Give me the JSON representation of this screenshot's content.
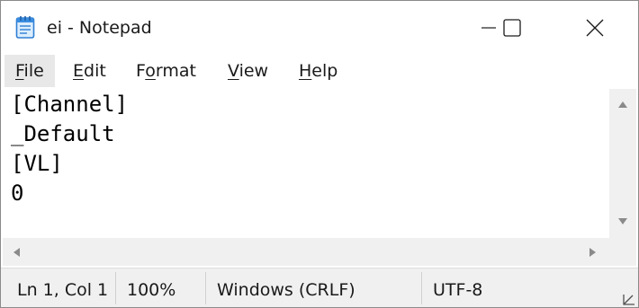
{
  "window": {
    "title": "ei - Notepad",
    "app_icon": "notepad-icon",
    "controls": [
      "minimize-icon",
      "maximize-icon",
      "close-icon"
    ]
  },
  "menu": {
    "items": [
      {
        "label": "File",
        "mnemonic": "F",
        "rest": "ile"
      },
      {
        "label": "Edit",
        "mnemonic": "E",
        "rest": "dit"
      },
      {
        "label": "Format",
        "pre": "F",
        "mnemonic": "o",
        "rest": "rmat"
      },
      {
        "label": "View",
        "mnemonic": "V",
        "rest": "iew"
      },
      {
        "label": "Help",
        "mnemonic": "H",
        "rest": "elp"
      }
    ]
  },
  "editor": {
    "content": "[Channel]\n_Default\n[VL]\n0"
  },
  "status": {
    "position": "Ln 1, Col 1",
    "zoom": "100%",
    "line_ending": "Windows (CRLF)",
    "encoding": "UTF-8"
  },
  "colors": {
    "status_bg": "#f0f0f0",
    "menu_highlight": "#e8e8e8",
    "icon_accent": "#3a8de0"
  }
}
